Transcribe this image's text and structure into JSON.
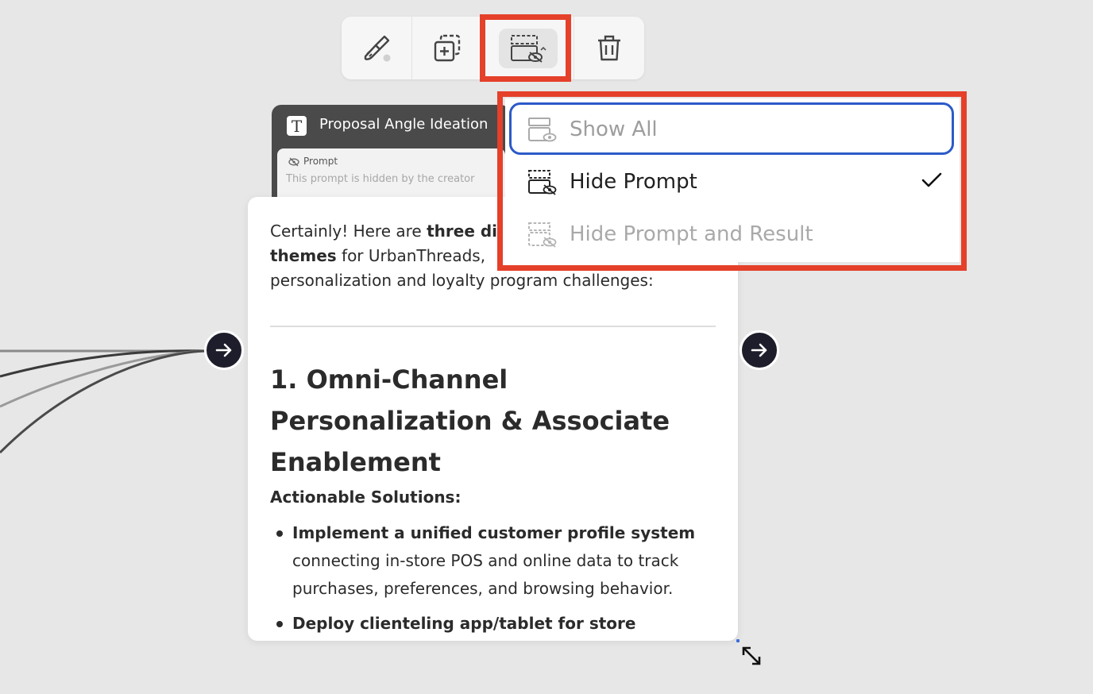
{
  "toolbar": {
    "buttons": [
      {
        "name": "style-button",
        "icon": "paint-brush-icon"
      },
      {
        "name": "duplicate-button",
        "icon": "add-copy-icon"
      },
      {
        "name": "visibility-button",
        "icon": "hide-eye-icon",
        "active": true
      },
      {
        "name": "delete-button",
        "icon": "trash-icon"
      }
    ]
  },
  "node": {
    "title": "Proposal Angle Ideation",
    "prompt_label": "Prompt",
    "prompt_hidden_text": "This prompt is hidden by the creator",
    "result": {
      "intro_1": "Certainly! Here are ",
      "intro_bold_1": "three di",
      "intro_bold_2": "themes",
      "intro_2": " for UrbanThreads, ",
      "intro_3": "personalization and loyalty program challenges:",
      "heading": "1. Omni-Channel Personalization & Associate Enablement",
      "subheading": "Actionable Solutions:",
      "bullets": [
        {
          "bold": "Implement a unified customer profile system",
          "text": " connecting in-store POS and online data to track purchases, preferences, and browsing behavior."
        },
        {
          "bold": "Deploy clienteling app/tablet for store",
          "text": ""
        }
      ]
    }
  },
  "visibility_menu": {
    "items": [
      {
        "label": "Show All",
        "state": "focused",
        "icon": "show-all-icon"
      },
      {
        "label": "Hide Prompt",
        "state": "selected",
        "icon": "hide-prompt-icon"
      },
      {
        "label": "Hide Prompt and Result",
        "state": "disabled",
        "icon": "hide-prompt-and-result-icon"
      }
    ]
  },
  "colors": {
    "highlight": "#e5402a",
    "focus_ring": "#2c5ac8",
    "handle": "#1d1d2b",
    "canvas": "#e7e7e7"
  }
}
